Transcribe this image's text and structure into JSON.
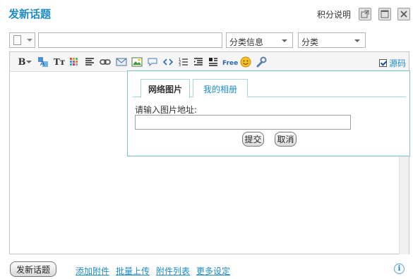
{
  "header": {
    "title": "发新话题",
    "help_label": "积分说明"
  },
  "form": {
    "subject_value": "",
    "category_info": "分类信息",
    "category": "分类"
  },
  "toolbar": {
    "source_label": "源码",
    "source_checked": true,
    "free_label": "Free",
    "bold_label": "B",
    "size_label": "Tт"
  },
  "popup": {
    "tabs": [
      {
        "label": "网络图片",
        "active": true
      },
      {
        "label": "我的相册",
        "active": false
      }
    ],
    "url_label": "请输入图片地址:",
    "url_value": "",
    "submit_label": "提交",
    "cancel_label": "取消"
  },
  "footer": {
    "post_label": "发新话题",
    "links": [
      "添加附件",
      "批量上传",
      "附件列表",
      "更多设定"
    ]
  },
  "colors": {
    "accent": "#1c8bc7",
    "popup_border": "#7fc3c9"
  }
}
